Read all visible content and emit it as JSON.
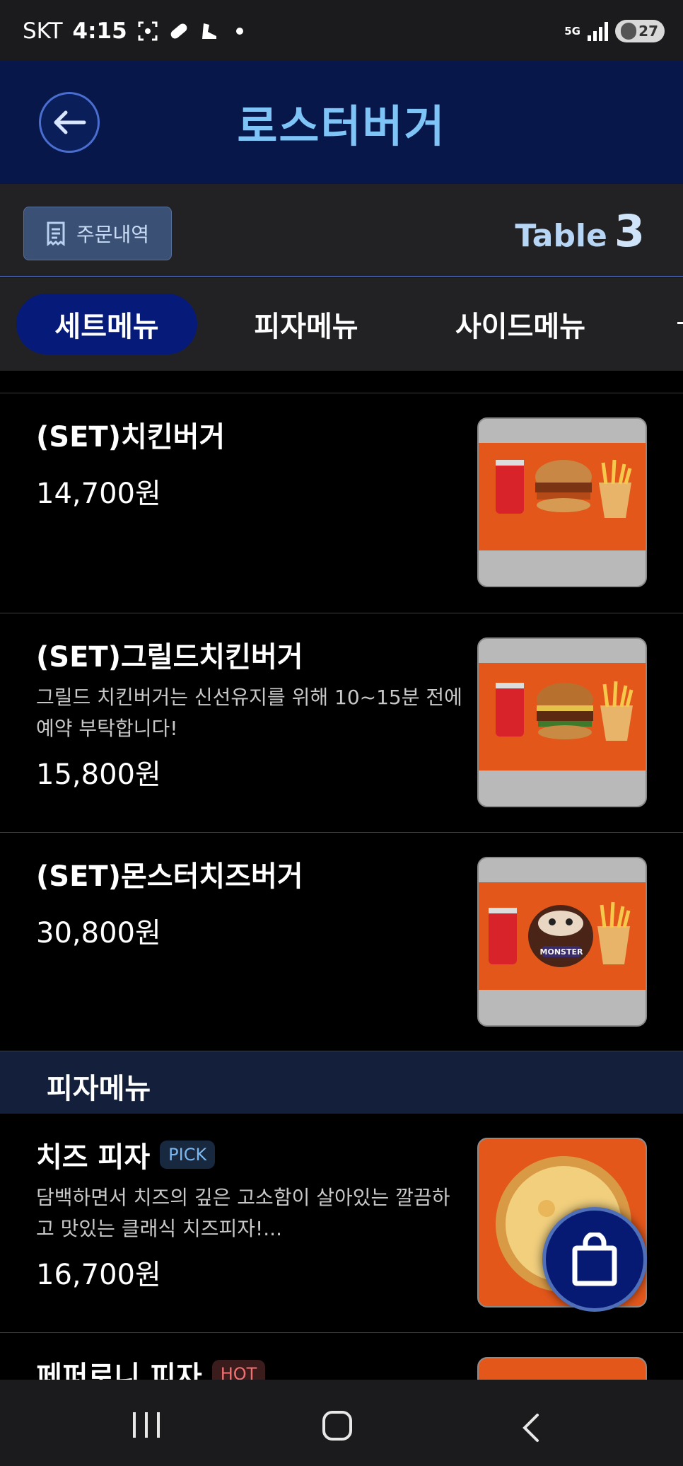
{
  "status_bar": {
    "carrier": "SKT",
    "time": "4:15",
    "network": "5G",
    "battery": "27"
  },
  "header": {
    "title": "로스터버거"
  },
  "subbar": {
    "order_history_label": "주문내역",
    "table_label": "Table",
    "table_number": "3"
  },
  "tabs": [
    {
      "label": "세트메뉴",
      "active": true
    },
    {
      "label": "피자메뉴",
      "active": false
    },
    {
      "label": "사이드메뉴",
      "active": false
    }
  ],
  "items": [
    {
      "name": "(SET)치킨버거",
      "desc": "",
      "price": "14,700원",
      "badge": ""
    },
    {
      "name": "(SET)그릴드치킨버거",
      "desc": "그릴드 치킨버거는 신선유지를 위해 10~15분 전에 예약 부탁합니다!",
      "price": "15,800원",
      "badge": ""
    },
    {
      "name": "(SET)몬스터치즈버거",
      "desc": "",
      "price": "30,800원",
      "badge": ""
    },
    {
      "name": "치즈 피자",
      "desc": "담백하면서 치즈의 깊은 고소함이 살아있는 깔끔하고 맛있는 클래식 치즈피자!...",
      "price": "16,700원",
      "badge": "PICK"
    },
    {
      "name": "페퍼로니 피자",
      "desc": "",
      "price": "",
      "badge": "HOT"
    }
  ],
  "section": {
    "pizza_header": "피자메뉴"
  },
  "thumb_labels": {
    "monster": "MONSTER"
  },
  "colors": {
    "header_bg": "#07174a",
    "title": "#7ec4f7",
    "active_tab": "#061a7a",
    "thumb_orange": "#e3571b"
  }
}
